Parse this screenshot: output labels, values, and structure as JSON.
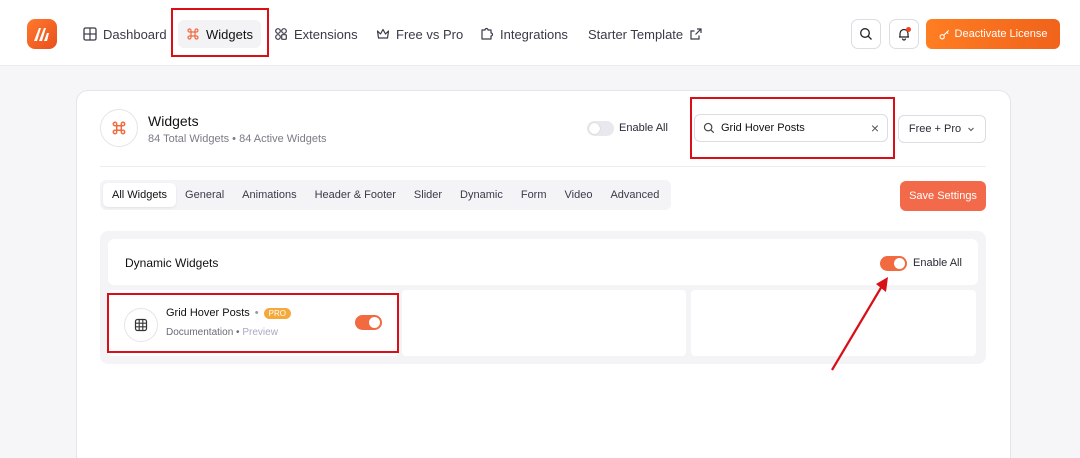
{
  "nav": {
    "items": [
      {
        "label": "Dashboard",
        "icon": "grid-icon"
      },
      {
        "label": "Widgets",
        "icon": "command-icon",
        "active": true
      },
      {
        "label": "Extensions",
        "icon": "extensions-icon"
      },
      {
        "label": "Free vs Pro",
        "icon": "crown-icon"
      },
      {
        "label": "Integrations",
        "icon": "puzzle-icon"
      },
      {
        "label": "Starter Template",
        "icon": "external-link-icon"
      }
    ],
    "deactivate_label": "Deactivate License"
  },
  "header": {
    "title": "Widgets",
    "subtitle": "84 Total Widgets • 84 Active Widgets",
    "enable_all_label": "Enable All",
    "search_value": "Grid Hover Posts",
    "filter_value": "Free + Pro"
  },
  "tabs": [
    "All Widgets",
    "General",
    "Animations",
    "Header & Footer",
    "Slider",
    "Dynamic",
    "Form",
    "Video",
    "Advanced"
  ],
  "save_label": "Save Settings",
  "section": {
    "title": "Dynamic Widgets",
    "enable_all_label": "Enable All",
    "enable_all_on": true
  },
  "widget": {
    "name": "Grid Hover Posts",
    "separator": "•",
    "badge": "PRO",
    "doc_label": "Documentation",
    "preview_label": "Preview",
    "enabled": true
  },
  "colors": {
    "accent": "#f26a3f",
    "annotation": "#d90f17"
  }
}
